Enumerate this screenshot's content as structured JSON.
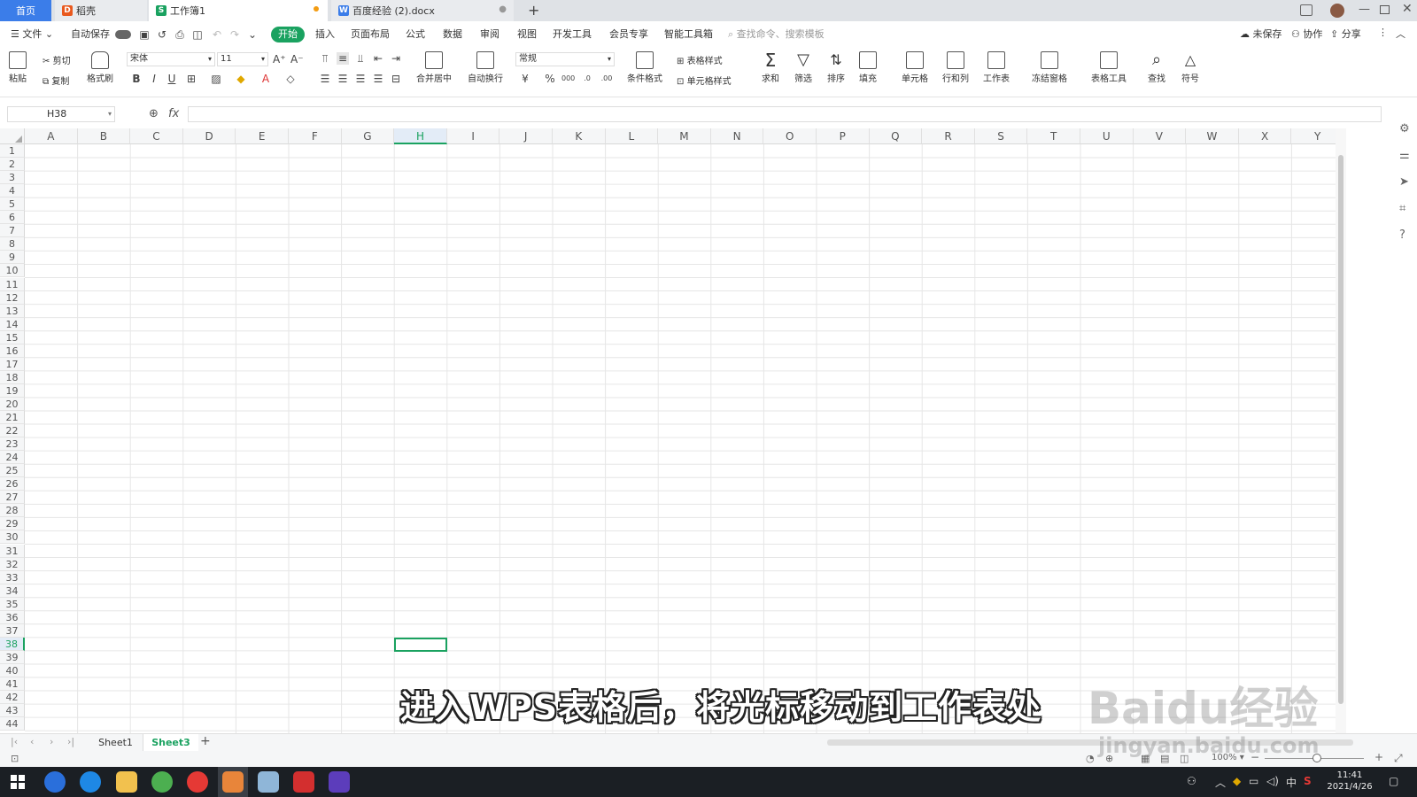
{
  "tabs": [
    {
      "label": "首页"
    },
    {
      "label": "稻壳"
    },
    {
      "label": "工作簿1"
    },
    {
      "label": "百度经验 (2).docx"
    }
  ],
  "menu": {
    "file": "文件",
    "autosave": "自动保存",
    "items": [
      "开始",
      "插入",
      "页面布局",
      "公式",
      "数据",
      "审阅",
      "视图",
      "开发工具",
      "会员专享",
      "智能工具箱"
    ],
    "search_placeholder": "查找命令、搜索模板",
    "unsaved": "未保存",
    "collab": "协作",
    "share": "分享"
  },
  "ribbon": {
    "paste": "粘贴",
    "cut": "剪切",
    "copy": "复制",
    "format_painter": "格式刷",
    "font": "宋体",
    "font_size": "11",
    "merge": "合并居中",
    "wrap": "自动换行",
    "number_format": "常规",
    "cond_format": "条件格式",
    "table_style": "表格样式",
    "cell_style": "单元格样式",
    "sum": "求和",
    "filter": "筛选",
    "sort": "排序",
    "fill": "填充",
    "cell": "单元格",
    "rowcol": "行和列",
    "worksheet": "工作表",
    "freeze": "冻结窗格",
    "table_tools": "表格工具",
    "find": "查找",
    "symbol": "符号"
  },
  "formula": {
    "cell_ref": "H38",
    "fx": "fx",
    "value": ""
  },
  "grid": {
    "columns": [
      "A",
      "B",
      "C",
      "D",
      "E",
      "F",
      "G",
      "H",
      "I",
      "J",
      "K",
      "L",
      "M",
      "N",
      "O",
      "P",
      "Q",
      "R",
      "S",
      "T",
      "U",
      "V",
      "W",
      "X",
      "Y"
    ],
    "active_col": "H",
    "active_row": 38,
    "row_count": 44
  },
  "sheets": {
    "tabs": [
      "Sheet1",
      "Sheet3"
    ],
    "active": "Sheet3"
  },
  "status": {
    "zoom": "100%"
  },
  "subtitle": "进入WPS表格后，将光标移动到工作表处",
  "watermark": {
    "logo": "Baidu经验",
    "url": "jingyan.baidu.com"
  },
  "taskbar": {
    "time": "11:41",
    "date": "2021/4/26",
    "ime": "中"
  },
  "colors": {
    "accent": "#1aa260",
    "tab_blue": "#3b7de9",
    "taskbar": "#1b1f24"
  }
}
